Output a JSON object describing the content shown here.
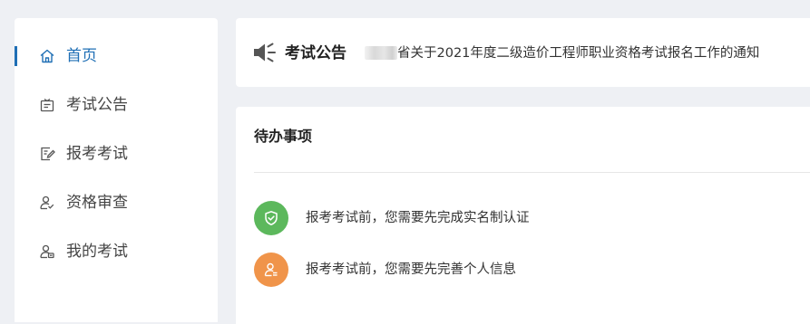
{
  "sidebar": {
    "items": [
      {
        "label": "首页",
        "icon": "home-icon",
        "active": true
      },
      {
        "label": "考试公告",
        "icon": "announcement-icon",
        "active": false
      },
      {
        "label": "报考考试",
        "icon": "edit-form-icon",
        "active": false
      },
      {
        "label": "资格审查",
        "icon": "user-check-icon",
        "active": false
      },
      {
        "label": "我的考试",
        "icon": "user-exam-icon",
        "active": false
      }
    ]
  },
  "notice": {
    "title": "考试公告",
    "icon": "speaker-icon",
    "text": "省关于2021年度二级造价工程师职业资格考试报名工作的通知"
  },
  "todo": {
    "title": "待办事项",
    "items": [
      {
        "text": "报考考试前，您需要先完成实名制认证",
        "icon": "shield-check-icon",
        "color": "#5cb85c"
      },
      {
        "text": "报考考试前，您需要先完善个人信息",
        "icon": "user-info-icon",
        "color": "#f0944a"
      }
    ]
  },
  "colors": {
    "accent": "#1f6fb5",
    "background": "#eef0f4"
  }
}
